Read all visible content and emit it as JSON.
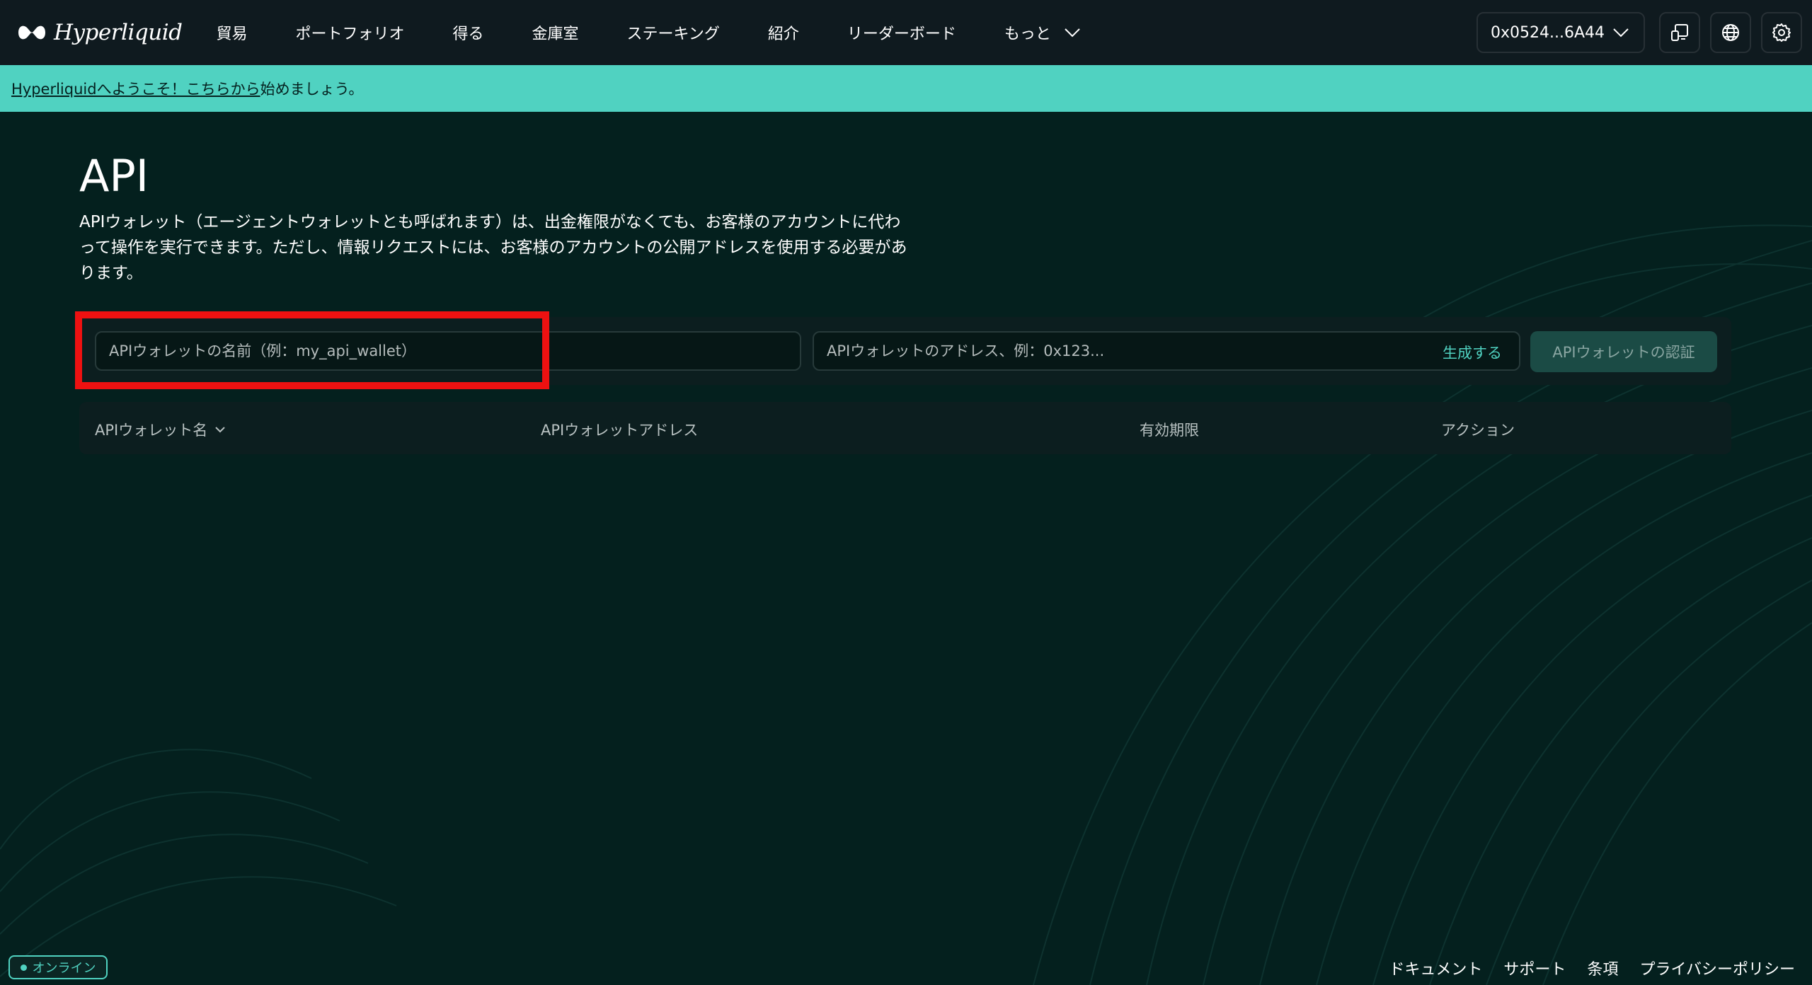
{
  "brand": {
    "name": "Hyperliquid"
  },
  "nav": {
    "items": [
      {
        "label": "貿易"
      },
      {
        "label": "ポートフォリオ"
      },
      {
        "label": "得る"
      },
      {
        "label": "金庫室"
      },
      {
        "label": "ステーキング"
      },
      {
        "label": "紹介"
      },
      {
        "label": "リーダーボード"
      }
    ],
    "more_label": "もっと",
    "wallet_address": "0x0524...6A44"
  },
  "banner": {
    "link_text": "Hyperliquidへようこそ！こちらから",
    "suffix_text": "始めましょう。"
  },
  "page": {
    "title": "API",
    "description": "APIウォレット（エージェントウォレットとも呼ばれます）は、出金権限がなくても、お客様のアカウントに代わって操作を実行できます。ただし、情報リクエストには、お客様のアカウントの公開アドレスを使用する必要があります。"
  },
  "form": {
    "name_placeholder": "APIウォレットの名前（例：my_api_wallet）",
    "address_placeholder": "APIウォレットのアドレス、例：0x123...",
    "generate_label": "生成する",
    "authorize_label": "APIウォレットの認証"
  },
  "table": {
    "columns": [
      "APIウォレット名",
      "APIウォレットアドレス",
      "有効期限",
      "アクション"
    ]
  },
  "footer": {
    "status": "オンライン",
    "links": [
      "ドキュメント",
      "サポート",
      "条項",
      "プライバシーポリシー"
    ]
  },
  "colors": {
    "background": "#04201e",
    "navbar": "#0f1a1f",
    "accent": "#50d2c1",
    "highlight": "#ee1111"
  }
}
